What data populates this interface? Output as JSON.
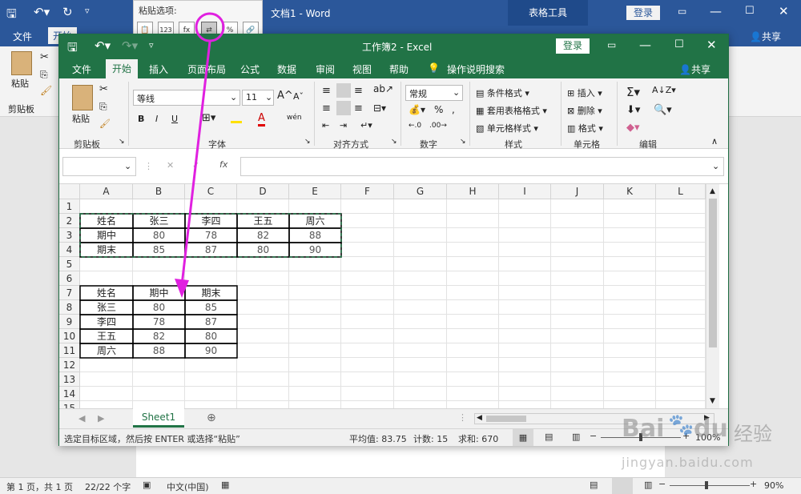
{
  "word": {
    "title": "文档1 - Word",
    "tools_label": "表格工具",
    "login": "登录",
    "share": "共享",
    "tabs": [
      "文件",
      "开始"
    ],
    "ribbon": {
      "paste": "粘贴",
      "clipboard": "剪贴板"
    },
    "status": {
      "page": "第 1 页，共 1 页",
      "words": "22/22 个字",
      "lang": "中文(中国)",
      "zoom": "90%"
    }
  },
  "paste_popup": {
    "title": "粘贴选项:",
    "values_label": "123"
  },
  "excel": {
    "title": "工作簿2 - Excel",
    "login": "登录",
    "share": "共享",
    "tabs": [
      "文件",
      "开始",
      "插入",
      "页面布局",
      "公式",
      "数据",
      "审阅",
      "视图",
      "帮助",
      "操作说明搜索"
    ],
    "ribbon": {
      "paste": "粘贴",
      "groups": [
        "剪贴板",
        "字体",
        "对齐方式",
        "数字",
        "样式",
        "单元格",
        "编辑"
      ],
      "font_name": "等线",
      "font_size": "11",
      "number_format": "常规",
      "styles": [
        "条件格式",
        "套用表格格式",
        "单元格样式"
      ],
      "cells": [
        "插入",
        "删除",
        "格式"
      ],
      "bold": "B",
      "italic": "I",
      "underline": "U",
      "font_color": "A",
      "wen": "wén",
      "fx": "fx"
    },
    "columns": [
      "A",
      "B",
      "C",
      "D",
      "E",
      "F",
      "G",
      "H",
      "I",
      "J",
      "K",
      "L"
    ],
    "rows": [
      "1",
      "2",
      "3",
      "4",
      "5",
      "6",
      "7",
      "8",
      "9",
      "10",
      "11",
      "12",
      "13",
      "14",
      "15"
    ],
    "table1": [
      [
        "姓名",
        "张三",
        "李四",
        "王五",
        "周六"
      ],
      [
        "期中",
        "80",
        "78",
        "82",
        "88"
      ],
      [
        "期末",
        "85",
        "87",
        "80",
        "90"
      ]
    ],
    "table2": [
      [
        "姓名",
        "期中",
        "期末"
      ],
      [
        "张三",
        "80",
        "85"
      ],
      [
        "李四",
        "78",
        "87"
      ],
      [
        "王五",
        "82",
        "80"
      ],
      [
        "周六",
        "88",
        "90"
      ]
    ],
    "sheet_tab": "Sheet1",
    "status": {
      "msg": "选定目标区域，然后按 ENTER 或选择“粘贴”",
      "avg": "平均值: 83.75",
      "count": "计数: 15",
      "sum": "求和: 670",
      "zoom": "100%"
    }
  },
  "watermark": {
    "brand": "Bai",
    "brand2": "du",
    "jingyan": "经验",
    "url": "jingyan.baidu.com"
  },
  "colors": {
    "word": "#2b579a",
    "excel": "#217346",
    "arrow": "#e020e0"
  }
}
